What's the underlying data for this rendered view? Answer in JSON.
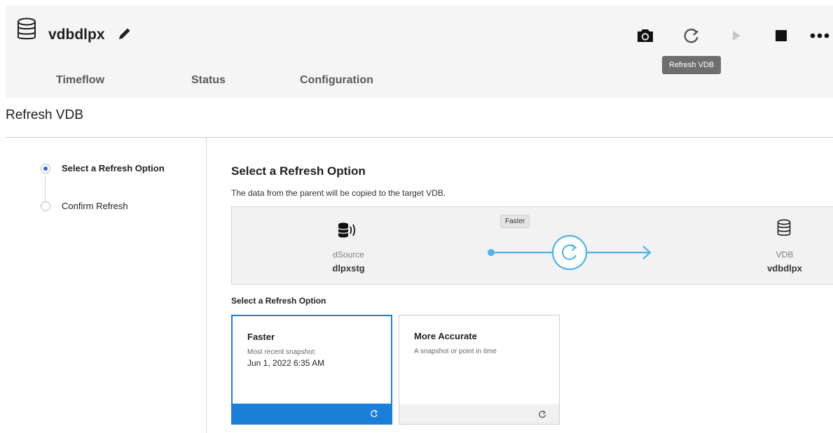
{
  "header": {
    "vdb_name": "vdbdlpx",
    "tabs": [
      {
        "label": "Timeflow"
      },
      {
        "label": "Status"
      },
      {
        "label": "Configuration"
      }
    ],
    "toolbar": {
      "snapshot_icon": "camera-icon",
      "refresh_icon": "refresh-icon",
      "start_icon": "play-icon",
      "stop_icon": "stop-icon",
      "more_icon": "more-horizontal-icon",
      "tooltip": "Refresh VDB"
    }
  },
  "page": {
    "title": "Refresh VDB"
  },
  "wizard": {
    "steps": [
      {
        "label": "Select a Refresh Option",
        "active": true
      },
      {
        "label": "Confirm Refresh",
        "active": false
      }
    ]
  },
  "main": {
    "title": "Select a Refresh Option",
    "description": "The data from the parent will be copied to the target VDB.",
    "flow": {
      "mode_label": "Faster",
      "source": {
        "type": "dSource",
        "name": "dlpxstg"
      },
      "target": {
        "type": "VDB",
        "name": "vdbdlpx"
      }
    },
    "options_title": "Select a Refresh Option",
    "options": [
      {
        "title": "Faster",
        "subtitle": "Most recent snapshot:",
        "detail": "Jun 1, 2022 6:35 AM",
        "selected": true
      },
      {
        "title": "More Accurate",
        "subtitle": "A snapshot or point in time",
        "selected": false
      }
    ]
  },
  "colors": {
    "accent": "#1a7fd8",
    "flow_line": "#4db3ea"
  }
}
